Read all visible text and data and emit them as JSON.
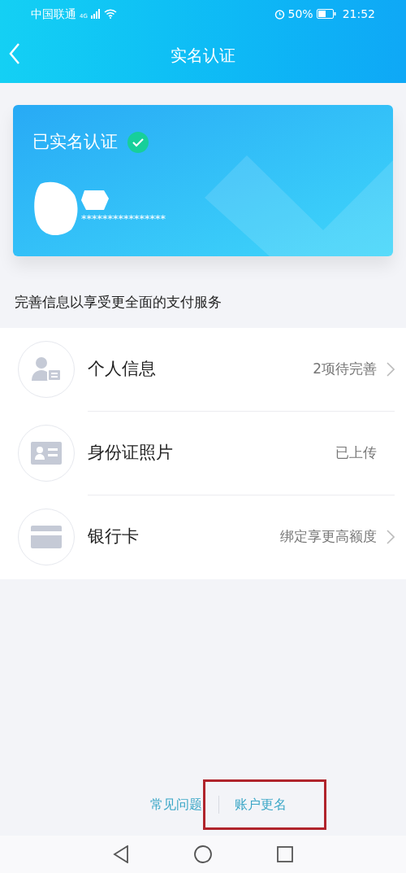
{
  "status_bar": {
    "carrier": "中国联通",
    "network": "4G",
    "battery": "50%",
    "time": "21:52"
  },
  "header": {
    "title": "实名认证"
  },
  "card": {
    "status": "已实名认证",
    "verified": true,
    "masked_id": "****************"
  },
  "section_title": "完善信息以享受更全面的支付服务",
  "items": [
    {
      "label": "个人信息",
      "value": "2项待完善",
      "has_arrow": true
    },
    {
      "label": "身份证照片",
      "value": "已上传",
      "has_arrow": false
    },
    {
      "label": "银行卡",
      "value": "绑定享更高额度",
      "has_arrow": true
    }
  ],
  "footer_links": [
    {
      "label": "常见问题",
      "highlighted": false
    },
    {
      "label": "账户更名",
      "highlighted": true
    }
  ]
}
